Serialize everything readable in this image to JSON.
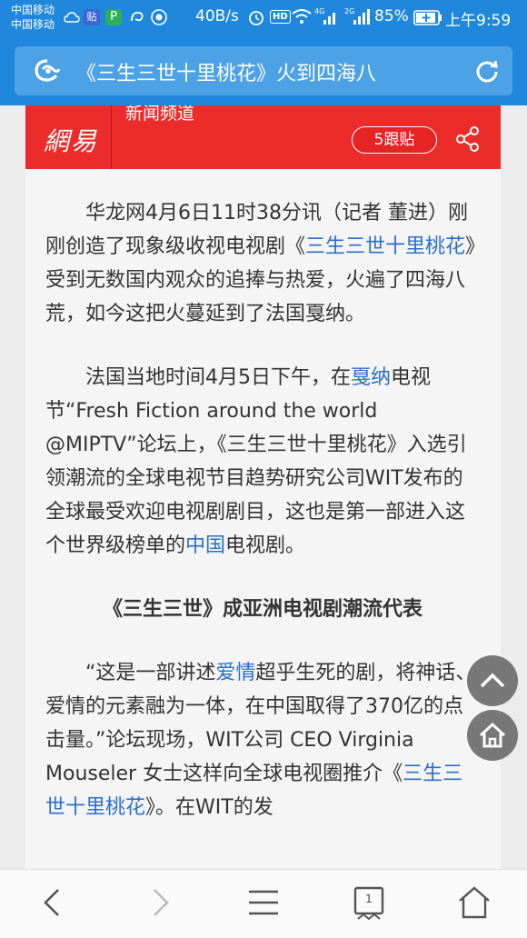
{
  "status": {
    "carrier1": "中国移动",
    "carrier2": "中国移动",
    "tieba_badge": "贴",
    "speed": "40B/s",
    "hd": "HD",
    "net4g": "4G",
    "net2g": "2G",
    "battery": "85%",
    "time": "上午9:59"
  },
  "urlbar": {
    "title": "《三生三世十里桃花》火到四海八"
  },
  "netease": {
    "logo": "網易",
    "channel": "新闻频道",
    "follow_label": "5跟贴"
  },
  "article": {
    "p1": {
      "a": "华龙网4月6日11时38分讯（记者  董进）刚刚创造了现象级收视电视剧《",
      "link": "三生三世十里桃花",
      "b": "》受到无数国内观众的追捧与热爱，火遍了四海八荒，如今这把火蔓延到了法国戛纳。"
    },
    "p2": {
      "a": "法国当地时间4月5日下午，在",
      "link1": "戛纳",
      "b": "电视节“Fresh Fiction around the world @MIPTV”论坛上，《三生三世十里桃花》入选引领潮流的全球电视节目趋势研究公司WIT发布的全球最受欢迎电视剧剧目，这也是第一部进入这个世界级榜单的",
      "link2": "中国",
      "c": "电视剧。"
    },
    "subhead": "《三生三世》成亚洲电视剧潮流代表",
    "p3": {
      "a": "“这是一部讲述",
      "link1": "爱情",
      "b": "超乎生死的剧，将神话、爱情的元素融为一体，在中国取得了370亿的点击量。”论坛现场，WIT公司 CEO Virginia Mouseler 女士这样向全球电视圈推介《",
      "link2": "三生三世十里桃花",
      "c": "》。在WIT的发"
    }
  },
  "bottomnav": {
    "tab_count": "1"
  },
  "colors": {
    "accent": "#1f88dc",
    "netease_red": "#ec2b2b",
    "link": "#2a6fc9"
  }
}
